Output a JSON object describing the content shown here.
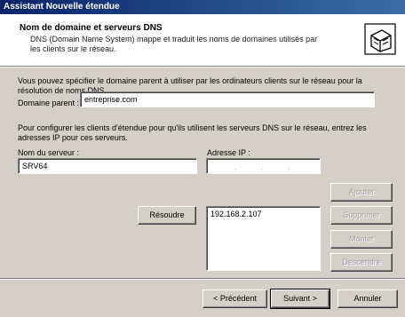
{
  "window": {
    "title": "Assistant Nouvelle étendue"
  },
  "header": {
    "title": "Nom de domaine et serveurs DNS",
    "description": "DNS (Domain Name System) mappe et traduit les noms de domaines utilisés par les clients sur le réseau."
  },
  "intro": "Vous pouvez spécifier le domaine parent à utiliser par les ordinateurs clients sur le réseau pour la résolution de noms DNS.",
  "parent_domain": {
    "label": "Domaine parent :",
    "value": "entreprise.com"
  },
  "config_text": "Pour configurer les clients d'étendue pour qu'ils utilisent les serveurs DNS sur le réseau, entrez les adresses IP pour ces serveurs.",
  "server": {
    "label": "Nom du serveur :",
    "value": "SRV64",
    "resolve_label": "Résoudre"
  },
  "ip": {
    "label": "Adresse IP :",
    "list": [
      "192.168.2.107"
    ],
    "add_label": "Ajouter",
    "remove_label": "Supprimer",
    "up_label": "Monter",
    "down_label": "Descendre"
  },
  "footer": {
    "back_label": "< Précédent",
    "next_label": "Suivant >",
    "cancel_label": "Annuler"
  }
}
